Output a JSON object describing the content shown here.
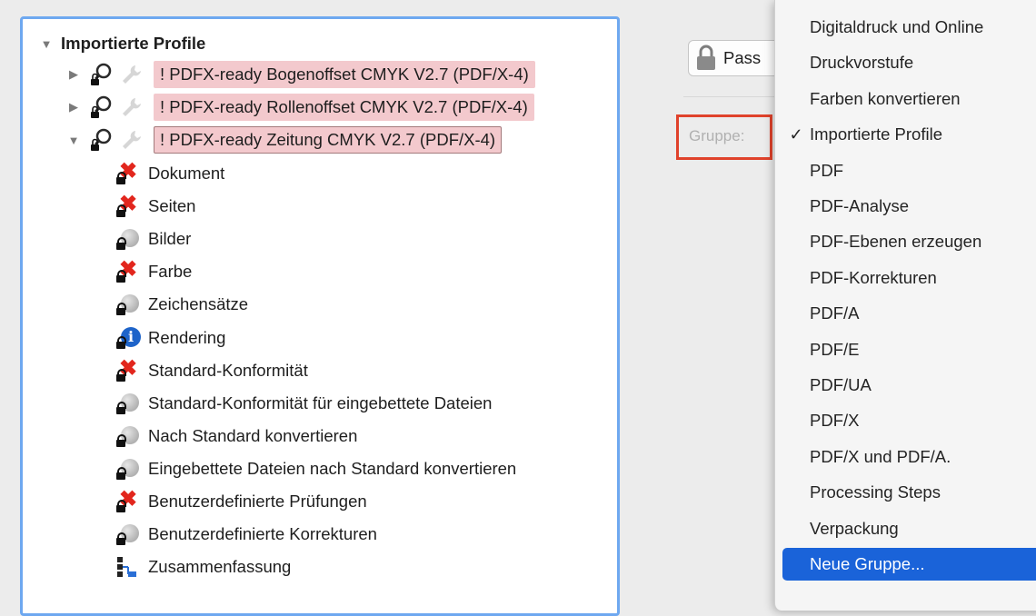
{
  "tree": {
    "root_label": "Importierte Profile",
    "profiles": [
      {
        "label": "! PDFX-ready Bogenoffset CMYK V2.7 (PDF/X-4)",
        "expanded": false,
        "selected": false
      },
      {
        "label": "! PDFX-ready Rollenoffset CMYK V2.7 (PDF/X-4)",
        "expanded": false,
        "selected": false
      },
      {
        "label": "! PDFX-ready Zeitung CMYK V2.7 (PDF/X-4)",
        "expanded": true,
        "selected": true
      }
    ],
    "children": [
      {
        "label": "Dokument",
        "icon": "error-x-icon"
      },
      {
        "label": "Seiten",
        "icon": "error-x-icon"
      },
      {
        "label": "Bilder",
        "icon": "inactive-disc-icon"
      },
      {
        "label": "Farbe",
        "icon": "error-x-icon"
      },
      {
        "label": "Zeichensätze",
        "icon": "inactive-disc-icon"
      },
      {
        "label": "Rendering",
        "icon": "info-icon"
      },
      {
        "label": "Standard-Konformität",
        "icon": "error-x-icon"
      },
      {
        "label": "Standard-Konformität für eingebettete Dateien",
        "icon": "inactive-disc-icon"
      },
      {
        "label": "Nach Standard konvertieren",
        "icon": "inactive-disc-icon"
      },
      {
        "label": "Eingebettete Dateien nach Standard konvertieren",
        "icon": "inactive-disc-icon"
      },
      {
        "label": "Benutzerdefinierte Prüfungen",
        "icon": "error-x-icon"
      },
      {
        "label": "Benutzerdefinierte Korrekturen",
        "icon": "inactive-disc-icon"
      },
      {
        "label": "Zusammenfassung",
        "icon": "summary-icon"
      }
    ]
  },
  "right_pane": {
    "pass_button_label": "Pass",
    "gruppe_label": "Gruppe:"
  },
  "group_menu": {
    "items": [
      {
        "label": "Digitaldruck und Online",
        "checked": false,
        "active": false
      },
      {
        "label": "Druckvorstufe",
        "checked": false,
        "active": false
      },
      {
        "label": "Farben konvertieren",
        "checked": false,
        "active": false
      },
      {
        "label": "Importierte Profile",
        "checked": true,
        "active": false
      },
      {
        "label": "PDF",
        "checked": false,
        "active": false
      },
      {
        "label": "PDF-Analyse",
        "checked": false,
        "active": false
      },
      {
        "label": "PDF-Ebenen erzeugen",
        "checked": false,
        "active": false
      },
      {
        "label": "PDF-Korrekturen",
        "checked": false,
        "active": false
      },
      {
        "label": "PDF/A",
        "checked": false,
        "active": false
      },
      {
        "label": "PDF/E",
        "checked": false,
        "active": false
      },
      {
        "label": "PDF/UA",
        "checked": false,
        "active": false
      },
      {
        "label": "PDF/X",
        "checked": false,
        "active": false
      },
      {
        "label": "PDF/X und PDF/A.",
        "checked": false,
        "active": false
      },
      {
        "label": "Processing Steps",
        "checked": false,
        "active": false
      },
      {
        "label": "Verpackung",
        "checked": false,
        "active": false
      },
      {
        "label": "Neue Gruppe...",
        "checked": false,
        "active": true
      }
    ],
    "check_glyph": "✓"
  },
  "colors": {
    "selection_blue": "#1a63d9",
    "profile_highlight": "#f3c9cd",
    "annotation_red": "#e0422b",
    "focus_ring": "#6ea8f0"
  }
}
